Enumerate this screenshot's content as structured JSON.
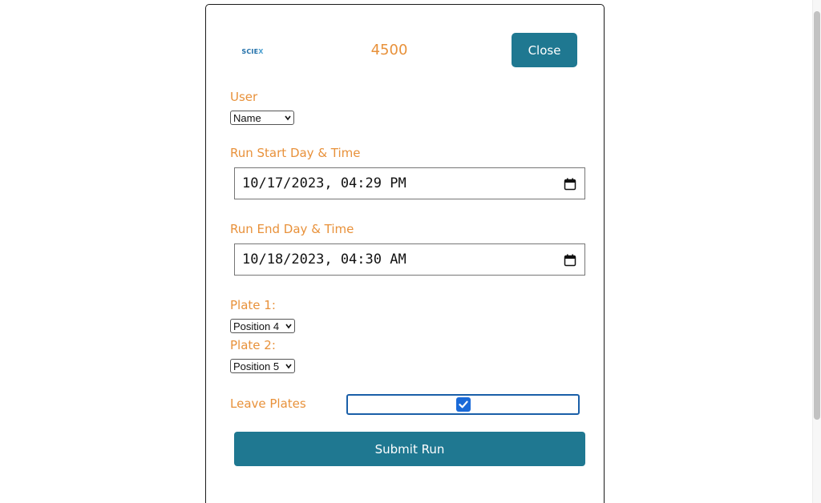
{
  "header": {
    "logo_text_main": "SCIE",
    "logo_text_accent": "X",
    "instrument": "4500",
    "close_label": "Close"
  },
  "form": {
    "user": {
      "label": "User",
      "selected": "Name"
    },
    "run_start": {
      "label": "Run Start Day & Time",
      "value": "10/17/2023, 04:29 PM"
    },
    "run_end": {
      "label": "Run End Day & Time",
      "value": "10/18/2023, 04:30 AM"
    },
    "plate1": {
      "label": "Plate 1:",
      "selected": "Position 4"
    },
    "plate2": {
      "label": "Plate 2:",
      "selected": "Position 5"
    },
    "leave_plates": {
      "label": "Leave Plates",
      "checked": true
    },
    "submit_label": "Submit Run"
  },
  "colors": {
    "accent_orange": "#e8913a",
    "primary_teal": "#1f7891",
    "checkbox_blue": "#1a6ad8"
  }
}
